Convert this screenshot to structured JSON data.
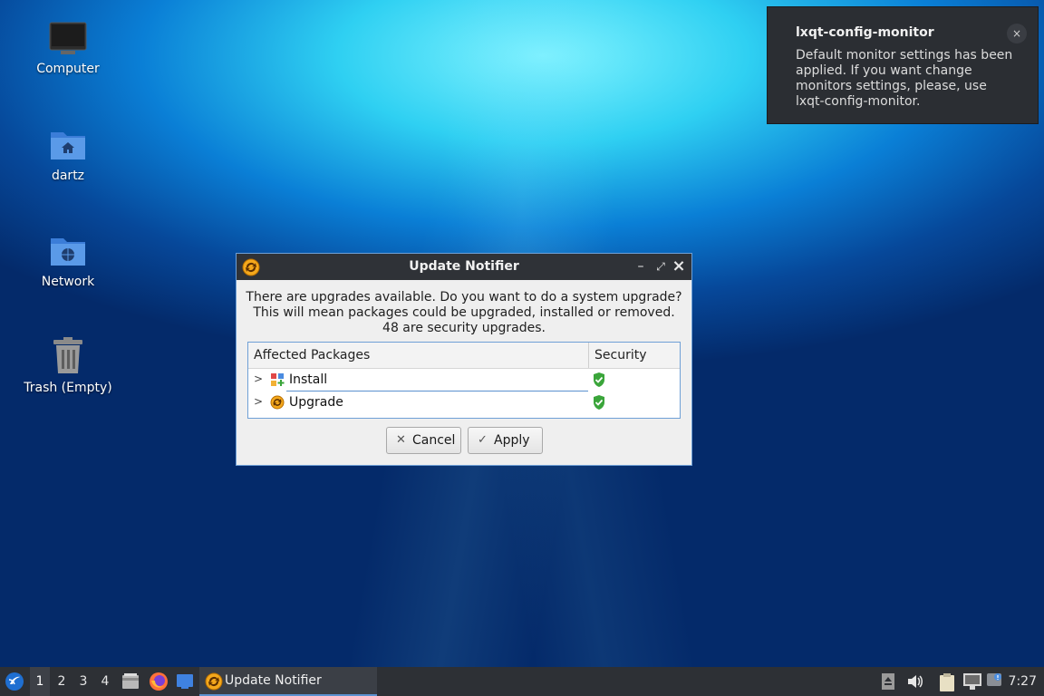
{
  "desktop": {
    "icons": [
      {
        "label": "Computer",
        "icon": "computer-icon"
      },
      {
        "label": "dartz",
        "icon": "home-folder-icon"
      },
      {
        "label": "Network",
        "icon": "network-folder-icon"
      },
      {
        "label": "Trash (Empty)",
        "icon": "trash-icon"
      }
    ]
  },
  "notification": {
    "title": "lxqt-config-monitor",
    "body": "Default monitor settings has been applied. If you want change monitors settings, please, use lxqt-config-monitor.",
    "close_label": "×"
  },
  "dialog": {
    "title": "Update Notifier",
    "message_lines": [
      "There are upgrades available. Do you want to do a system upgrade?",
      "This will mean packages could be upgraded, installed or removed.",
      "48 are security upgrades."
    ],
    "columns": [
      "Affected Packages",
      "Security"
    ],
    "rows": [
      {
        "label": "Install",
        "icon": "install-icon",
        "security": "shield-check-icon"
      },
      {
        "label": "Upgrade",
        "icon": "upgrade-icon",
        "security": "shield-check-icon"
      }
    ],
    "buttons": {
      "cancel": "Cancel",
      "apply": "Apply"
    },
    "title_buttons": {
      "minimize": "–",
      "maximize": "⤢",
      "close": "×"
    }
  },
  "taskbar": {
    "desktops": [
      "1",
      "2",
      "3",
      "4"
    ],
    "active_desktop": "1",
    "task_label": "Update Notifier",
    "clock": "7:27"
  },
  "colors": {
    "accent": "#5b91cf",
    "titlebar": "#2f3237",
    "taskbar": "#2d3035",
    "shield_green": "#3aa53a",
    "updater_orange": "#f4a81c"
  }
}
